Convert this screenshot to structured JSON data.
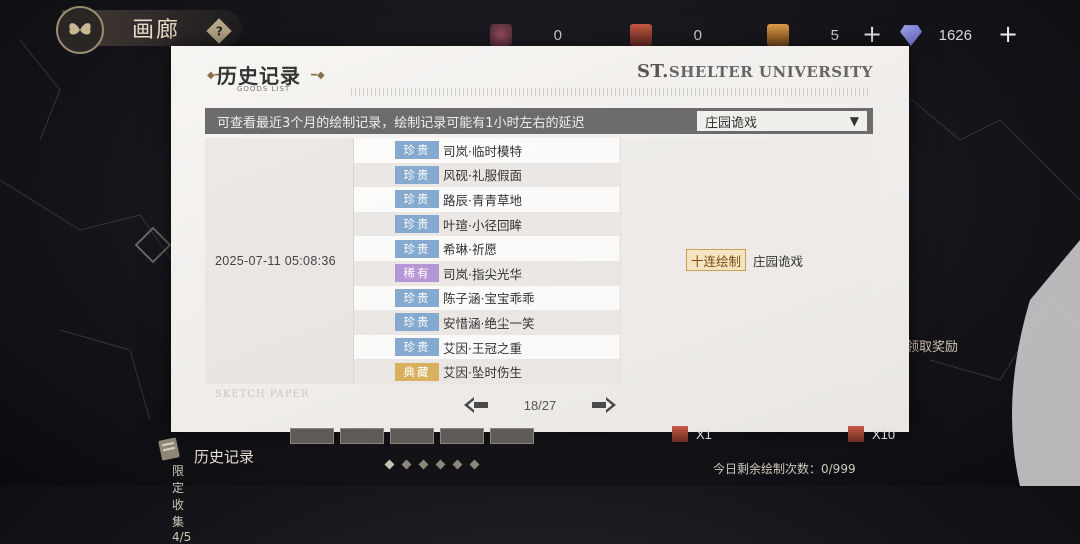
{
  "header": {
    "title": "画廊",
    "help_glyph": "?"
  },
  "resources": [
    {
      "name": "resource-1",
      "value": "0",
      "color": "#7a3a46"
    },
    {
      "name": "resource-2",
      "value": "0",
      "color": "#b04a3a"
    },
    {
      "name": "resource-3",
      "value": "5",
      "color": "#c67a2e"
    },
    {
      "name": "diamond",
      "value": "1626",
      "color": "#7a7fd6"
    }
  ],
  "dialog": {
    "title": "历史记录",
    "subtitle": "GOODS LIST",
    "brand_prefix": "ST.",
    "brand": "SHELTER UNIVERSITY",
    "notice": "可查看最近3个月的绘制记录，绘制记录可能有1小时左右的延迟",
    "pool_select": {
      "value": "庄园诡戏"
    },
    "record": {
      "time": "2025-07-11  05:08:36",
      "draw_type": "十连绘制",
      "pool": "庄园诡戏",
      "items": [
        {
          "rarity": "珍贵",
          "name": "司岚·临时模特",
          "color": "#86a9cf"
        },
        {
          "rarity": "珍贵",
          "name": "风砚·礼服假面",
          "color": "#86a9cf"
        },
        {
          "rarity": "珍贵",
          "name": "路辰·青青草地",
          "color": "#86a9cf"
        },
        {
          "rarity": "珍贵",
          "name": "叶瑄·小径回眸",
          "color": "#86a9cf"
        },
        {
          "rarity": "珍贵",
          "name": "希琳·祈愿",
          "color": "#86a9cf"
        },
        {
          "rarity": "稀有",
          "name": "司岚·指尖光华",
          "color": "#b796d6"
        },
        {
          "rarity": "珍贵",
          "name": "陈子涵·宝宝乖乖",
          "color": "#86a9cf"
        },
        {
          "rarity": "珍贵",
          "name": "安惜涵·绝尘一笑",
          "color": "#86a9cf"
        },
        {
          "rarity": "珍贵",
          "name": "艾因·王冠之重",
          "color": "#86a9cf"
        },
        {
          "rarity": "典藏",
          "name": "艾因·坠时伤生",
          "color": "#d9b15e"
        }
      ]
    },
    "pager": {
      "label": "18/27"
    },
    "sketch_label": "SKETCH PAPER"
  },
  "bottom": {
    "history_label": "历史记录",
    "limit_label": "限定收集 4/5",
    "draw_once": "X1",
    "draw_ten": "X10",
    "remain": "今日剩余绘制次数：0/999",
    "side_label": "领取奖励"
  }
}
